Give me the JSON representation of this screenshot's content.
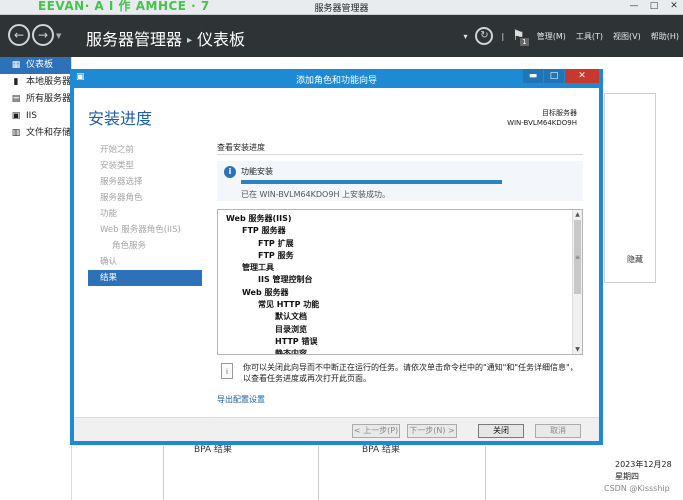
{
  "window": {
    "title": "服务器管理器",
    "signature": "EEVAN· A I 作 AMHCE · 7"
  },
  "ribbon": {
    "breadcrumb_app": "服务器管理器",
    "breadcrumb_page": "仪表板",
    "flag_count": "1",
    "menu": [
      "管理(M)",
      "工具(T)",
      "视图(V)",
      "帮助(H)"
    ]
  },
  "sidebar": {
    "items": [
      {
        "label": "仪表板",
        "icon": "dashboard-icon"
      },
      {
        "label": "本地服务器",
        "icon": "server-icon"
      },
      {
        "label": "所有服务器",
        "icon": "servers-icon"
      },
      {
        "label": "IIS",
        "icon": "iis-icon"
      },
      {
        "label": "文件和存储服务",
        "icon": "storage-icon"
      }
    ]
  },
  "background": {
    "hide_label": "隐藏",
    "bpa_label": "BPA 结果",
    "date_line1": "2023年12月28",
    "date_line2": "星期四",
    "watermark": "CSDN @Kissship"
  },
  "wizard": {
    "title": "添加角色和功能向导",
    "heading": "安装进度",
    "target_label": "目标服务器",
    "target_server": "WIN-BVLM64KDO9H",
    "steps": [
      {
        "label": "开始之前",
        "level": 0,
        "active": false
      },
      {
        "label": "安装类型",
        "level": 0,
        "active": false
      },
      {
        "label": "服务器选择",
        "level": 0,
        "active": false
      },
      {
        "label": "服务器角色",
        "level": 0,
        "active": false
      },
      {
        "label": "功能",
        "level": 0,
        "active": false
      },
      {
        "label": "Web 服务器角色(IIS)",
        "level": 0,
        "active": false
      },
      {
        "label": "角色服务",
        "level": 1,
        "active": false
      },
      {
        "label": "确认",
        "level": 0,
        "active": false
      },
      {
        "label": "结果",
        "level": 0,
        "active": true
      }
    ],
    "section_title": "查看安装进度",
    "progress": {
      "label": "功能安装",
      "fraction": 1.0,
      "status": "已在 WIN-BVLM64KDO9H 上安装成功。"
    },
    "results": [
      {
        "label": "Web 服务器(IIS)",
        "level": 0
      },
      {
        "label": "FTP 服务器",
        "level": 1
      },
      {
        "label": "FTP 扩展",
        "level": 2
      },
      {
        "label": "FTP 服务",
        "level": 2
      },
      {
        "label": "管理工具",
        "level": 1
      },
      {
        "label": "IIS 管理控制台",
        "level": 2
      },
      {
        "label": "Web 服务器",
        "level": 1
      },
      {
        "label": "常见 HTTP 功能",
        "level": 2
      },
      {
        "label": "默认文档",
        "level": 3
      },
      {
        "label": "目录浏览",
        "level": 3
      },
      {
        "label": "HTTP 错误",
        "level": 3
      },
      {
        "label": "静态内容",
        "level": 3
      }
    ],
    "note": "你可以关闭此向导而不中断正在运行的任务。请依次单击命令栏中的\"通知\"和\"任务详细信息\"，以查看任务进度或再次打开此页面。",
    "export_link": "导出配置设置",
    "buttons": {
      "previous": "< 上一步(P)",
      "next": "下一步(N) >",
      "close": "关闭",
      "cancel": "取消"
    }
  }
}
